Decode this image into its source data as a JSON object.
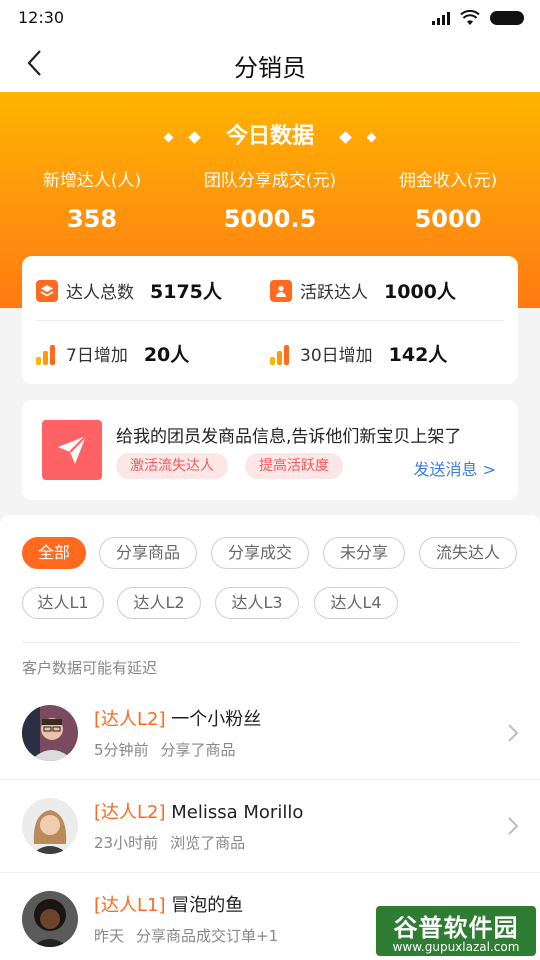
{
  "status_bar": {
    "time": "12:30",
    "icons": [
      "signal-icon",
      "wifi-icon",
      "battery-icon"
    ]
  },
  "nav": {
    "title": "分销员",
    "back_icon": "chevron-left-icon"
  },
  "hero": {
    "title": "今日数据",
    "stats": [
      {
        "label": "新增达人(人)",
        "value": "358"
      },
      {
        "label": "团队分享成交(元)",
        "value": "5000.5"
      },
      {
        "label": "佣金收入(元)",
        "value": "5000"
      }
    ]
  },
  "summary": {
    "metrics": [
      {
        "icon": "layers-icon",
        "label": "达人总数",
        "value": "5175人"
      },
      {
        "icon": "user-icon",
        "label": "活跃达人",
        "value": "1000人"
      },
      {
        "icon": "bar-chart-icon",
        "label": "7日增加",
        "value": "20人"
      },
      {
        "icon": "bar-chart-icon",
        "label": "30日增加",
        "value": "142人"
      }
    ]
  },
  "promo": {
    "icon": "send-icon",
    "text": "给我的团员发商品信息,告诉他们新宝贝上架了",
    "tags": [
      "激活流失达人",
      "提高活跃度"
    ],
    "link": "发送消息 >"
  },
  "filters": {
    "chips": [
      "全部",
      "分享商品",
      "分享成交",
      "未分享",
      "流失达人",
      "达人L1",
      "达人L2",
      "达人L3",
      "达人L4"
    ],
    "active": "全部"
  },
  "notice": "客户数据可能有延迟",
  "customers": [
    {
      "level": "[达人L2]",
      "name": "一个小粉丝",
      "time": "5分钟前",
      "action": "分享了商品"
    },
    {
      "level": "[达人L2]",
      "name": "Melissa Morillo",
      "time": "23小时前",
      "action": "浏览了商品"
    },
    {
      "level": "[达人L1]",
      "name": "冒泡的鱼",
      "time": "昨天",
      "action": "分享商品成交订单+1"
    }
  ],
  "watermark": {
    "title": "谷普软件园",
    "url": "www.gupuxlazal.com"
  },
  "colors": {
    "accent": "#ff6a1e",
    "hero_top": "#ffb400",
    "hero_bottom": "#ff7a12",
    "link": "#3c7fd8",
    "tag_bg": "#fde6e6",
    "tag_text": "#f15a5a"
  }
}
